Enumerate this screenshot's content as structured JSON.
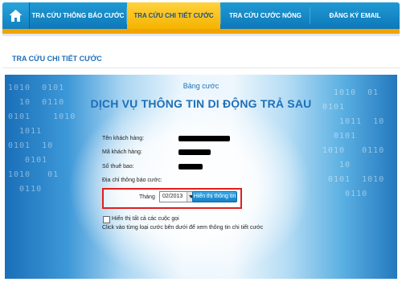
{
  "nav": {
    "home_icon": "home-icon",
    "tabs": [
      {
        "label": "TRA CỨU THÔNG BÁO CƯỚC",
        "active": false
      },
      {
        "label": "TRA CỨU CHI TIẾT CƯỚC",
        "active": true
      },
      {
        "label": "TRA CỨU CƯỚC NÓNG",
        "active": false
      },
      {
        "label": "ĐĂNG KÝ EMAIL",
        "active": false
      }
    ]
  },
  "page": {
    "title": "TRA CỨU CHI TIẾT CƯỚC"
  },
  "panel": {
    "caption": "Bảng cước",
    "heading": "DỊCH VỤ THÔNG TIN DI ĐỘNG TRẢ SAU",
    "fields": [
      {
        "label": "Tên khách hàng:",
        "value_redacted": true
      },
      {
        "label": "Mã khách hàng:",
        "value_redacted": true
      },
      {
        "label": "Số thuê bao:",
        "value_redacted": true
      },
      {
        "label": "Địa chỉ thông báo cước:",
        "value_redacted": false
      }
    ],
    "period": {
      "month_label": "Tháng",
      "month_value": "02/2013",
      "show_button": "Hiển thị thông tin"
    },
    "show_all_checkbox": {
      "label": "Hiển thị tất cả các cuộc gọi",
      "checked": false
    },
    "hint": "Click vào từng loại cước bên dưới để xem thông tin chi tiết cước"
  },
  "colors": {
    "nav_blue": "#1489c8",
    "nav_active": "#f5b400",
    "title_blue": "#1d6fb8",
    "highlight_red": "#e01f1f"
  }
}
